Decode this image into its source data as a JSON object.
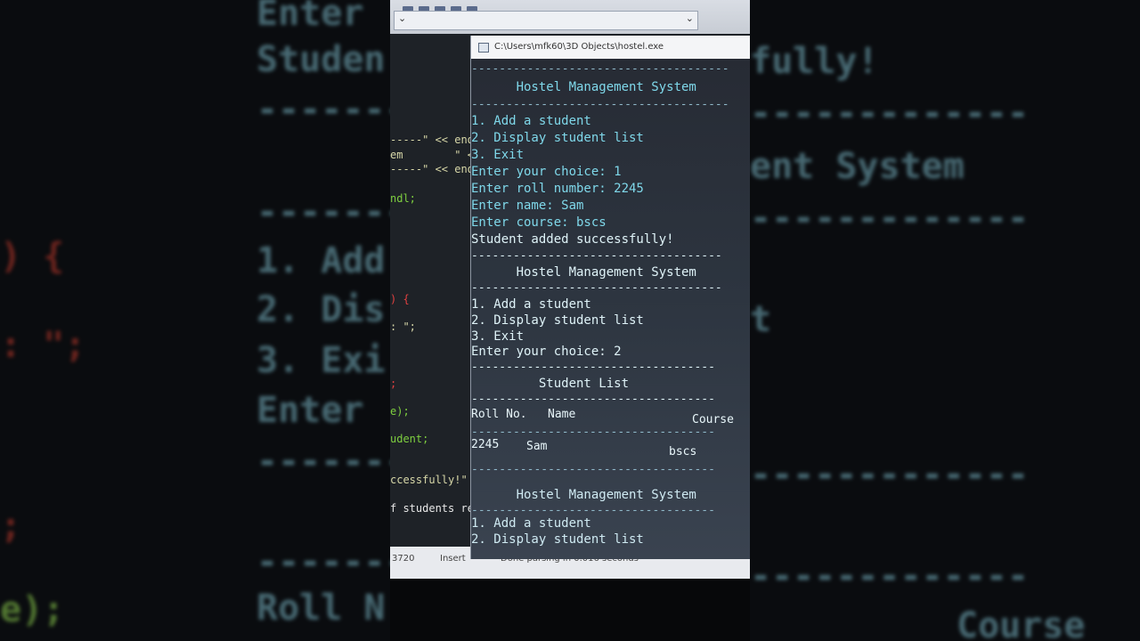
{
  "window": {
    "title": "C:\\Users\\mfk60\\3D Objects\\hostel.exe"
  },
  "console_lines": [
    {
      "text": "-------------------------------------",
      "kind": "dash"
    },
    {
      "text": "      Hostel Management System",
      "kind": "text"
    },
    {
      "text": "-------------------------------------",
      "kind": "dash"
    },
    {
      "text": "1. Add a student",
      "kind": "text"
    },
    {
      "text": "2. Display student list",
      "kind": "text"
    },
    {
      "text": "3. Exit",
      "kind": "text"
    },
    {
      "text": "Enter your choice: 1",
      "kind": "text"
    },
    {
      "text": "Enter roll number: 2245",
      "kind": "text"
    },
    {
      "text": "Enter name: Sam",
      "kind": "text"
    },
    {
      "text": "Enter course: bscs",
      "kind": "text"
    },
    {
      "text": "Student added successfully!",
      "kind": "text"
    },
    {
      "text": "------------------------------------",
      "kind": "dash"
    },
    {
      "text": "      Hostel Management System",
      "kind": "text"
    },
    {
      "text": "------------------------------------",
      "kind": "dash"
    },
    {
      "text": "1. Add a student",
      "kind": "text"
    },
    {
      "text": "2. Display student list",
      "kind": "text"
    },
    {
      "text": "3. Exit",
      "kind": "text"
    },
    {
      "text": "Enter your choice: 2",
      "kind": "text"
    },
    {
      "text": "-----------------------------------",
      "kind": "dash"
    },
    {
      "text": "         Student List",
      "kind": "text"
    },
    {
      "text": "-----------------------------------",
      "kind": "dash"
    }
  ],
  "table": {
    "headers": [
      "Roll No.",
      "Name",
      "Course"
    ],
    "rows": [
      [
        "2245",
        "Sam",
        "bscs"
      ]
    ]
  },
  "console_tail": [
    {
      "text": "-----------------------------------",
      "kind": "dash"
    },
    {
      "text": "-----------------------------------",
      "kind": "dash"
    },
    {
      "text": "      Hostel Management System",
      "kind": "text"
    },
    {
      "text": "-----------------------------------",
      "kind": "dash"
    },
    {
      "text": "1. Add a student",
      "kind": "text"
    },
    {
      "text": "2. Display student list",
      "kind": "text"
    }
  ],
  "editor_snippets": [
    {
      "text": "-----\" << end",
      "color": "str"
    },
    {
      "text": "em        \" <<",
      "color": "str"
    },
    {
      "text": "-----\" << end",
      "color": "str"
    },
    {
      "text": "ndl;",
      "color": "grn"
    },
    {
      "text": ") {",
      "color": "red"
    },
    {
      "text": ": \";",
      "color": "str"
    },
    {
      "text": ";",
      "color": "red"
    },
    {
      "text": "e);",
      "color": "grn"
    },
    {
      "text": "udent;",
      "color": "grn"
    },
    {
      "text": "ccessfully!\" <",
      "color": "str"
    },
    {
      "text": "f students rea",
      "color": "wht"
    }
  ],
  "statusbar": {
    "position": "3720",
    "mode": "Insert",
    "message": "Done parsing in 0.016 seconds"
  },
  "background_left": [
    "Enter",
    "Studen",
    "-------",
    "-------",
    ") {",
    "1. Add",
    "2. Dis",
    ": \";",
    "3. Exi",
    "Enter",
    "-------",
    ";",
    "-------",
    "e);",
    "Roll N"
  ],
  "background_right": [
    "fully!",
    "-------------",
    "ent System",
    "-------------",
    "t",
    "-------------",
    "-------------",
    "Course"
  ],
  "colors": {
    "console_text": "#7fd8ea",
    "console_bg": "#2d3540",
    "editor_bg": "#1e2227"
  }
}
